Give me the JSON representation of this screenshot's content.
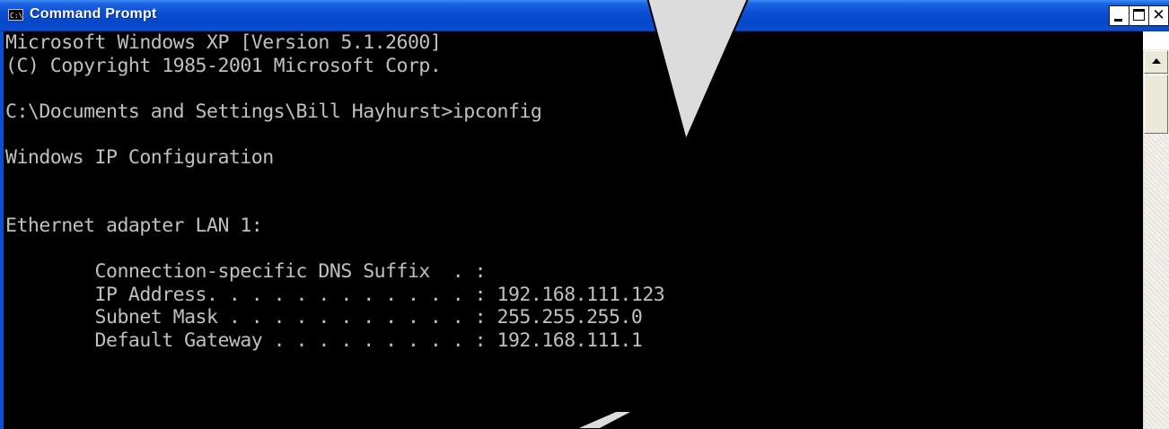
{
  "window": {
    "title": "Command Prompt",
    "icon": "console-icon",
    "icon_glyph": "C:\\",
    "controls": {
      "minimize": "minimize-icon",
      "maximize": "maximize-icon",
      "close": "close-icon"
    }
  },
  "console": {
    "lines": [
      "Microsoft Windows XP [Version 5.1.2600]",
      "(C) Copyright 1985-2001 Microsoft Corp.",
      "",
      "C:\\Documents and Settings\\Bill Hayhurst>ipconfig",
      "",
      "Windows IP Configuration",
      "",
      "",
      "Ethernet adapter LAN 1:",
      "",
      "        Connection-specific DNS Suffix  . :",
      "        IP Address. . . . . . . . . . . . : 192.168.111.123",
      "        Subnet Mask . . . . . . . . . . . : 255.255.255.0",
      "        Default Gateway . . . . . . . . . : 192.168.111.1"
    ]
  },
  "colors": {
    "titlebar": "#0a4fd4",
    "console_bg": "#000000",
    "console_text": "#c0c0c0",
    "callout_fill": "#dcdcdc"
  }
}
